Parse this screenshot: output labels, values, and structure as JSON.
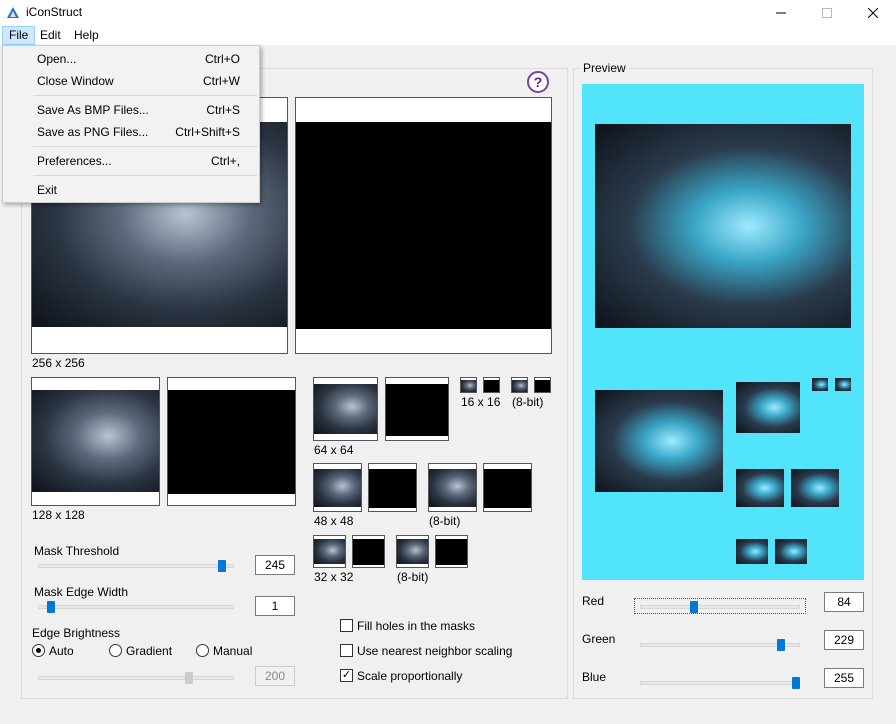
{
  "window": {
    "title": "iConStruct"
  },
  "menubar": {
    "file": "File",
    "edit": "Edit",
    "help": "Help"
  },
  "file_menu": [
    {
      "label": "Open...",
      "shortcut": "Ctrl+O"
    },
    {
      "label": "Close Window",
      "shortcut": "Ctrl+W"
    },
    {
      "label": "Save As BMP Files...",
      "shortcut": "Ctrl+S"
    },
    {
      "label": "Save as PNG Files...",
      "shortcut": "Ctrl+Shift+S"
    },
    {
      "label": "Preferences...",
      "shortcut": "Ctrl+,"
    },
    {
      "label": "Exit",
      "shortcut": ""
    }
  ],
  "help_button": "?",
  "sizes": {
    "s256": "256 x 256",
    "s128": "128 x 128",
    "s64": "64 x 64",
    "s48": "48 x 48",
    "s48_8bit": "(8-bit)",
    "s32": "32 x 32",
    "s32_8bit": "(8-bit)",
    "s16": "16 x 16",
    "s16_8bit": "(8-bit)"
  },
  "mask_threshold": {
    "label": "Mask Threshold",
    "value": "245",
    "level": 0.96
  },
  "mask_edge_width": {
    "label": "Mask Edge Width",
    "value": "1",
    "level": 0.05
  },
  "edge_brightness": {
    "label": "Edge Brightness",
    "options": {
      "auto": "Auto",
      "gradient": "Gradient",
      "manual": "Manual"
    },
    "selected": "Auto",
    "value": "200",
    "level": 0.78
  },
  "options": {
    "fill_holes": {
      "label": "Fill holes in the masks",
      "checked": false
    },
    "nearest_neighbor": {
      "label": "Use nearest neighbor scaling",
      "checked": false
    },
    "scale_prop": {
      "label": "Scale proportionally",
      "checked": true
    }
  },
  "preview": {
    "label": "Preview",
    "bg_color": "#52e4fb",
    "red": {
      "label": "Red",
      "value": "84",
      "level": 0.33
    },
    "green": {
      "label": "Green",
      "value": "229",
      "level": 0.9
    },
    "blue": {
      "label": "Blue",
      "value": "255",
      "level": 1.0
    }
  },
  "colors": {
    "accent": "#0078d7",
    "help": "#7b3fa0"
  }
}
